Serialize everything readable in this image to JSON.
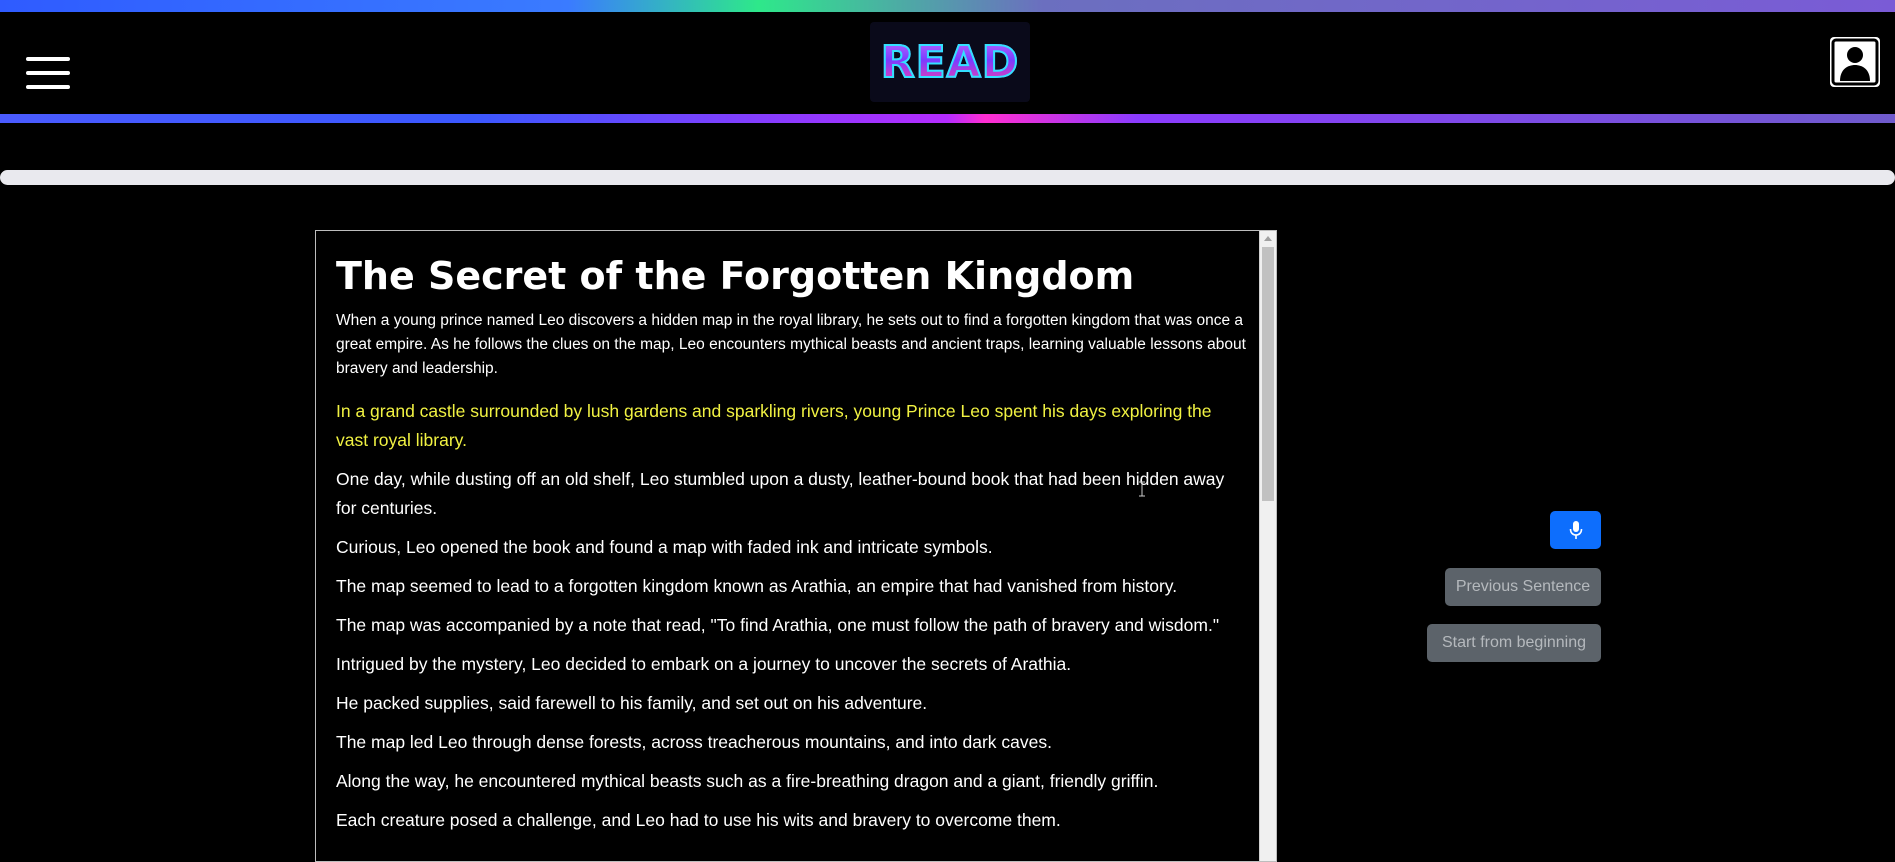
{
  "app": {
    "logo_text": "READ"
  },
  "header": {
    "menu_icon": "hamburger-menu-icon",
    "profile_icon": "user-profile-icon"
  },
  "progress": {
    "value_fraction": 0.0
  },
  "story": {
    "title": "The Secret of the Forgotten Kingdom",
    "summary": "When a young prince named Leo discovers a hidden map in the royal library, he sets out to find a forgotten kingdom that was once a great empire. As he follows the clues on the map, Leo encounters mythical beasts and ancient traps, learning valuable lessons about bravery and leadership.",
    "sentences": [
      "In a grand castle surrounded by lush gardens and sparkling rivers, young Prince Leo spent his days exploring the vast royal library.",
      "One day, while dusting off an old shelf, Leo stumbled upon a dusty, leather-bound book that had been hidden away for centuries.",
      "Curious, Leo opened the book and found a map with faded ink and intricate symbols.",
      "The map seemed to lead to a forgotten kingdom known as Arathia, an empire that had vanished from history.",
      "The map was accompanied by a note that read, \"To find Arathia, one must follow the path of bravery and wisdom.\"",
      "Intrigued by the mystery, Leo decided to embark on a journey to uncover the secrets of Arathia.",
      "He packed supplies, said farewell to his family, and set out on his adventure.",
      "The map led Leo through dense forests, across treacherous mountains, and into dark caves.",
      "Along the way, he encountered mythical beasts such as a fire-breathing dragon and a giant, friendly griffin.",
      "Each creature posed a challenge, and Leo had to use his wits and bravery to overcome them."
    ],
    "active_sentence_index": 0
  },
  "controls": {
    "mic_icon": "microphone-icon",
    "previous_label": "Previous Sentence",
    "start_label": "Start from beginning"
  },
  "colors": {
    "highlight": "#f1f242",
    "mic_button": "#0d6efd",
    "secondary_button": "#5c636a"
  }
}
